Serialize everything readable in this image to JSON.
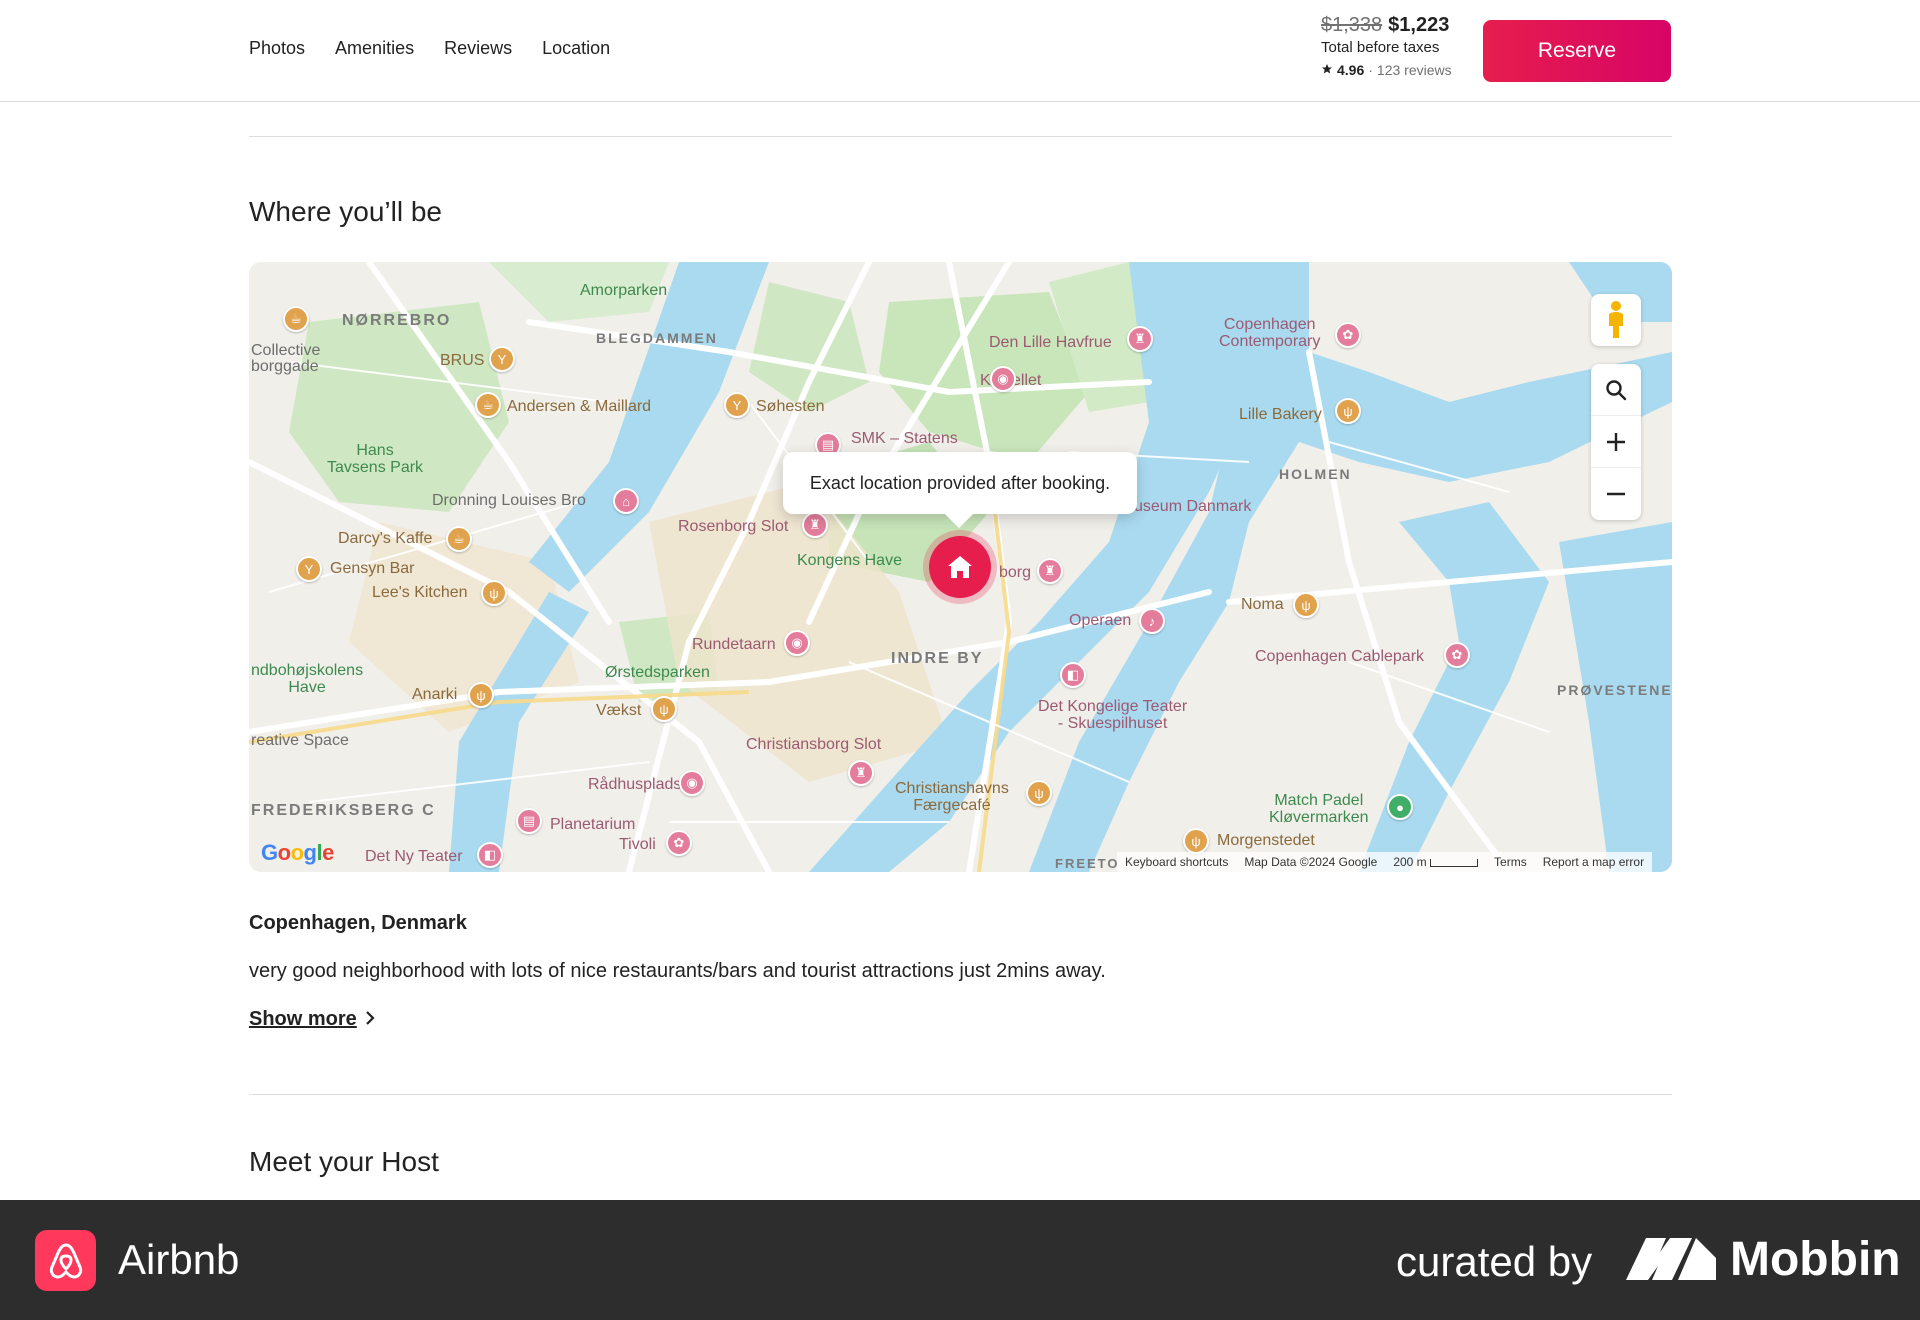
{
  "nav": {
    "links": [
      "Photos",
      "Amenities",
      "Reviews",
      "Location"
    ],
    "old_price": "$1,338",
    "new_price": "$1,223",
    "price_note": "Total before taxes",
    "rating": "4.96",
    "reviews": "123 reviews",
    "reserve_label": "Reserve",
    "accent_color": "#e61e4d"
  },
  "location_section": {
    "title": "Where you’ll be",
    "tooltip": "Exact location provided after booking.",
    "place": "Copenhagen, Denmark",
    "description": "very good neighborhood with lots of nice restaurants/bars and tourist attractions just 2mins away.",
    "show_more": "Show more"
  },
  "map": {
    "labels": {
      "norrebro": "NØRREBRO",
      "blegdammen": "BLEGDAMMEN",
      "holmen": "HOLMEN",
      "indre_by": "INDRE BY",
      "provestenen": "PRØVESTENEN",
      "frederiksberg": "FREDERIKSBERG C",
      "freeto": "FREETO",
      "amorparken": "Amorparken",
      "collective": "Collective",
      "borggade": "borggade",
      "brus": "BRUS",
      "andersen": "Andersen & Maillard",
      "sohesten": "Søhesten",
      "hans_tavsens": "Hans\nTavsens Park",
      "dronning": "Dronning Louises Bro",
      "darcys": "Darcy's Kaffe",
      "gensyn": "Gensyn Bar",
      "lees": "Lee's Kitchen",
      "hojskolens": "ndbohøjskolens\nHave",
      "anarki": "Anarki",
      "creative": "reative Space",
      "vaekst": "Vækst",
      "orsted": "Ørstedsparken",
      "rundetaarn": "Rundetaarn",
      "rosenborg": "Rosenborg Slot",
      "kongens": "Kongens Have",
      "smk": "SMK – Statens",
      "kastellet": "Kastellet",
      "havfrue": "Den Lille Havfrue",
      "contemporary": "Copenhagen\nContemporary",
      "lille_bakery": "Lille Bakery",
      "museum": "useum Danmark",
      "amalienborg": "borg",
      "operaen": "Operaen",
      "noma": "Noma",
      "cablepark": "Copenhagen Cablepark",
      "teater": "Det Kongelige Teater\n- Skuespilhuset",
      "christiansborg": "Christiansborg Slot",
      "raadhus": "Rådhuspladsen",
      "planetarium": "Planetarium",
      "tivoli": "Tivoli",
      "ny_teater": "Det Ny Teater",
      "faergecafe": "Christianshavns\nFærgecafé",
      "padel": "Match Padel\nKløvermarken",
      "morgenstedet": "Morgenstedet"
    },
    "google": "Google",
    "footer": {
      "shortcuts": "Keyboard shortcuts",
      "mapdata": "Map Data ©2024 Google",
      "scale": "200 m",
      "terms": "Terms",
      "report": "Report a map error"
    }
  },
  "host_section": {
    "title": "Meet your Host"
  },
  "brandbar": {
    "app": "Airbnb",
    "curated": "curated by",
    "mobbin": "Mobbin"
  }
}
